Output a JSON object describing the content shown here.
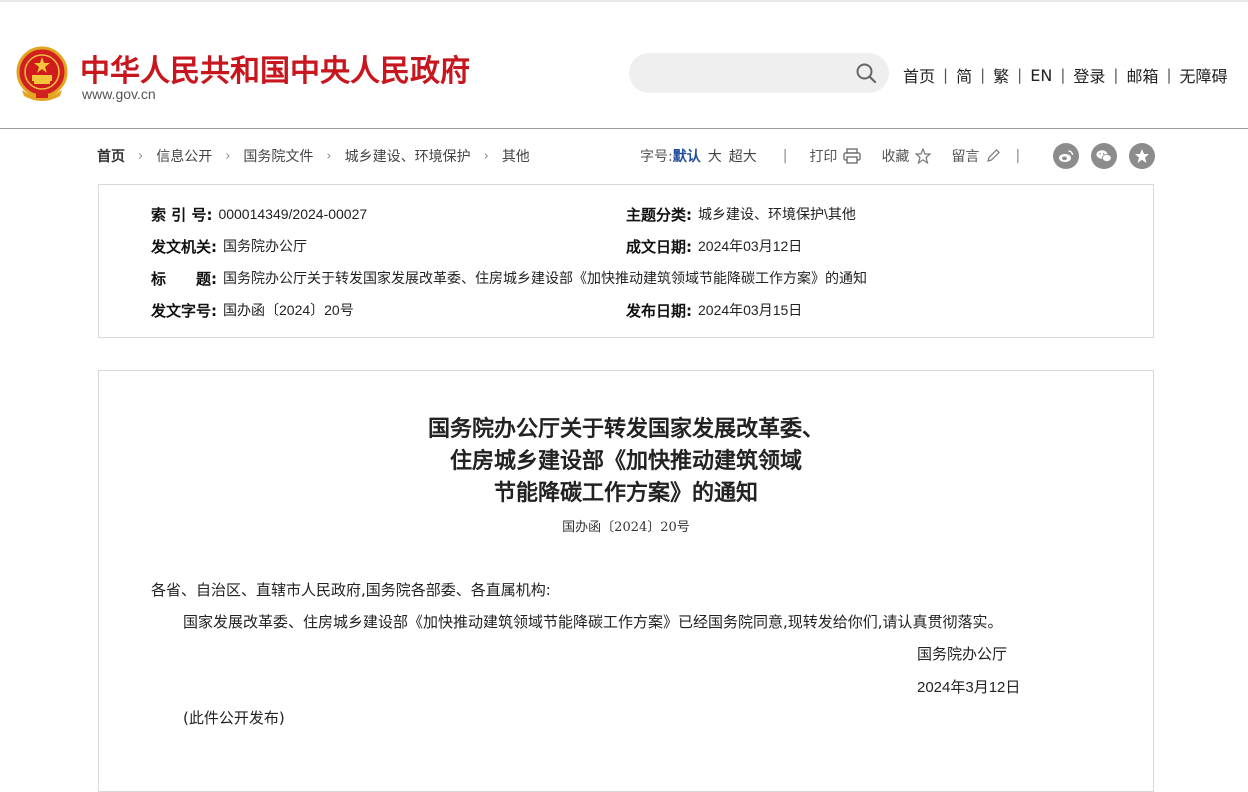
{
  "header": {
    "site_title": "中华人民共和国中央人民政府",
    "site_url": "www.gov.cn",
    "search": {
      "placeholder": "",
      "value": ""
    },
    "nav": [
      "首页",
      "简",
      "繁",
      "EN",
      "登录",
      "邮箱",
      "无障碍"
    ]
  },
  "breadcrumb": [
    "首页",
    "信息公开",
    "国务院文件",
    "城乡建设、环境保护",
    "其他"
  ],
  "tools": {
    "font_size_label": "字号:",
    "sizes": [
      "默认",
      "大",
      "超大"
    ],
    "print": "打印",
    "favorite": "收藏",
    "comment": "留言"
  },
  "social": [
    "weibo-icon",
    "wechat-icon",
    "share-icon"
  ],
  "info": {
    "index_label": "索 引 号:",
    "index_value": "000014349/2024-00027",
    "category_label": "主题分类:",
    "category_value": "城乡建设、环境保护\\其他",
    "issuer_label": "发文机关:",
    "issuer_value": "国务院办公厅",
    "written_date_label": "成文日期:",
    "written_date_value": "2024年03月12日",
    "title_label": "标　　题:",
    "title_value": "国务院办公厅关于转发国家发展改革委、住房城乡建设部《加快推动建筑领域节能降碳工作方案》的通知",
    "doc_number_label": "发文字号:",
    "doc_number_value": "国办函〔2024〕20号",
    "publish_date_label": "发布日期:",
    "publish_date_value": "2024年03月15日"
  },
  "article": {
    "title_lines": [
      "国务院办公厅关于转发国家发展改革委、",
      "住房城乡建设部《加快推动建筑领域",
      "节能降碳工作方案》的通知"
    ],
    "doc_number": "国办函〔2024〕20号",
    "salutation": "各省、自治区、直辖市人民政府,国务院各部委、各直属机构:",
    "body": "国家发展改革委、住房城乡建设部《加快推动建筑领域节能降碳工作方案》已经国务院同意,现转发给你们,请认真贯彻落实。",
    "signature": "国务院办公厅",
    "date": "2024年3月12日",
    "note": "(此件公开发布)"
  },
  "colors": {
    "brand_red": "#c8161e",
    "active_blue": "#214e9c",
    "icon_gray": "#8c8c8c"
  }
}
